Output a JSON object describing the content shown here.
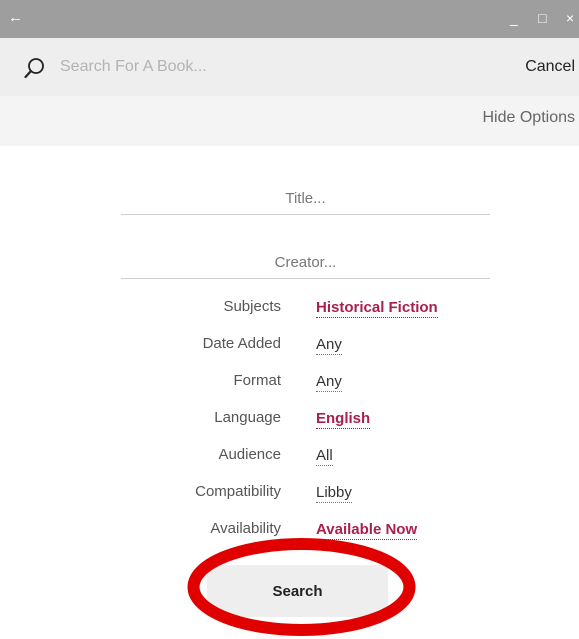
{
  "titlebar": {
    "back_icon": "arrow-left-icon",
    "minimize_glyph": "_",
    "maximize_glyph": "□",
    "close_glyph": "×",
    "background": "#9e9e9e"
  },
  "search": {
    "placeholder": "Search For A Book...",
    "value": "",
    "cancel_label": "Cancel",
    "icon": "magnifier-icon"
  },
  "options_toggle": {
    "label": "Hide Options"
  },
  "fields": {
    "title_placeholder": "Title...",
    "creator_placeholder": "Creator..."
  },
  "options": [
    {
      "label": "Subjects",
      "value": "Historical Fiction",
      "highlighted": true
    },
    {
      "label": "Date Added",
      "value": "Any",
      "highlighted": false
    },
    {
      "label": "Format",
      "value": "Any",
      "highlighted": false
    },
    {
      "label": "Language",
      "value": "English",
      "highlighted": true
    },
    {
      "label": "Audience",
      "value": "All",
      "highlighted": false
    },
    {
      "label": "Compatibility",
      "value": "Libby",
      "highlighted": false
    },
    {
      "label": "Availability",
      "value": "Available Now",
      "highlighted": true
    }
  ],
  "search_button": {
    "label": "Search"
  },
  "colors": {
    "accent": "#a8204c",
    "annotation_ring": "#e00000"
  }
}
